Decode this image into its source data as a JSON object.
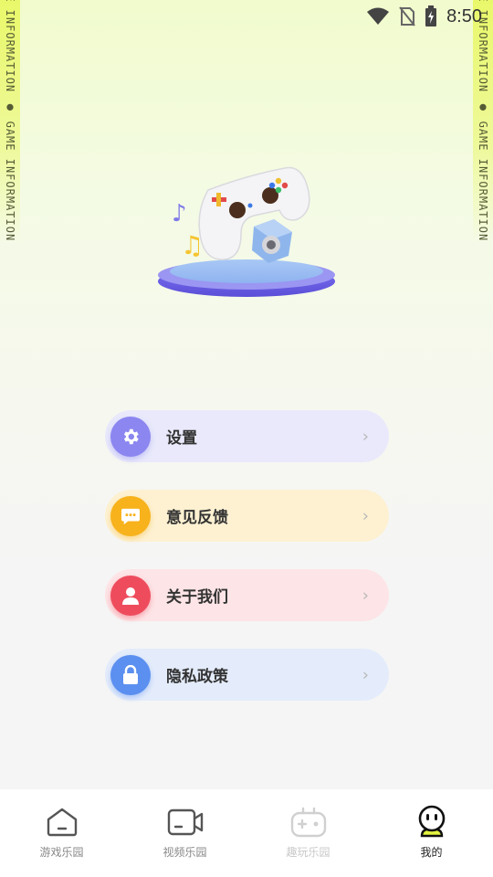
{
  "status_bar": {
    "time": "8:50"
  },
  "ribbon": {
    "text": "ME INFORMATION ● GAME INFORMATION"
  },
  "menu": {
    "items": [
      {
        "label": "设置",
        "chevron": "›",
        "icon": "gear-icon",
        "bg": "#e9e9fb",
        "icon_color": "#8b86f0"
      },
      {
        "label": "意见反馈",
        "chevron": "›",
        "icon": "chat-bubble-icon",
        "bg": "#fdf1d2",
        "icon_color": "#f7b21c"
      },
      {
        "label": "关于我们",
        "chevron": "›",
        "icon": "person-icon",
        "bg": "#fde4e6",
        "icon_color": "#ee4c5d"
      },
      {
        "label": "隐私政策",
        "chevron": "›",
        "icon": "lock-icon",
        "bg": "#e4ecfb",
        "icon_color": "#5b8ff0"
      }
    ]
  },
  "tabbar": {
    "tabs": [
      {
        "label": "游戏乐园",
        "icon": "home-icon",
        "state": "inactive"
      },
      {
        "label": "视频乐园",
        "icon": "video-camera-icon",
        "state": "inactive"
      },
      {
        "label": "趣玩乐园",
        "icon": "gamepad-icon",
        "state": "dim"
      },
      {
        "label": "我的",
        "icon": "smiley-avatar-icon",
        "state": "active"
      }
    ]
  }
}
